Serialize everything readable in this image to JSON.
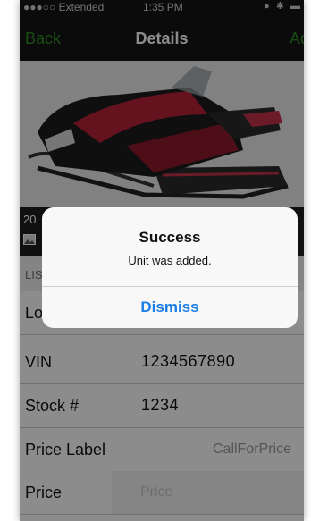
{
  "colors": {
    "accent": "#2e8b24",
    "alert_button": "#1a7ee6",
    "navbar": "#141414"
  },
  "statusbar": {
    "carrier": "●●●○○ Extended",
    "time": "1:35 PM",
    "right": "● ✱ ▬"
  },
  "nav": {
    "back_label": "Back",
    "title": "Details",
    "add_label": "Ad"
  },
  "photo": {
    "subject": "snowmobile-photo"
  },
  "caption": {
    "year_text": "20"
  },
  "section": {
    "header": "LIS"
  },
  "rows": {
    "location_label": "Lo",
    "vin_label": "VIN",
    "vin_value": "1234567890",
    "stock_label": "Stock #",
    "stock_value": "1234",
    "price_label_label": "Price Label",
    "price_label_value": "CallForPrice",
    "price_label": "Price",
    "price_placeholder": "Price"
  },
  "alert": {
    "title": "Success",
    "message": "Unit was added.",
    "dismiss_label": "Dismiss"
  }
}
